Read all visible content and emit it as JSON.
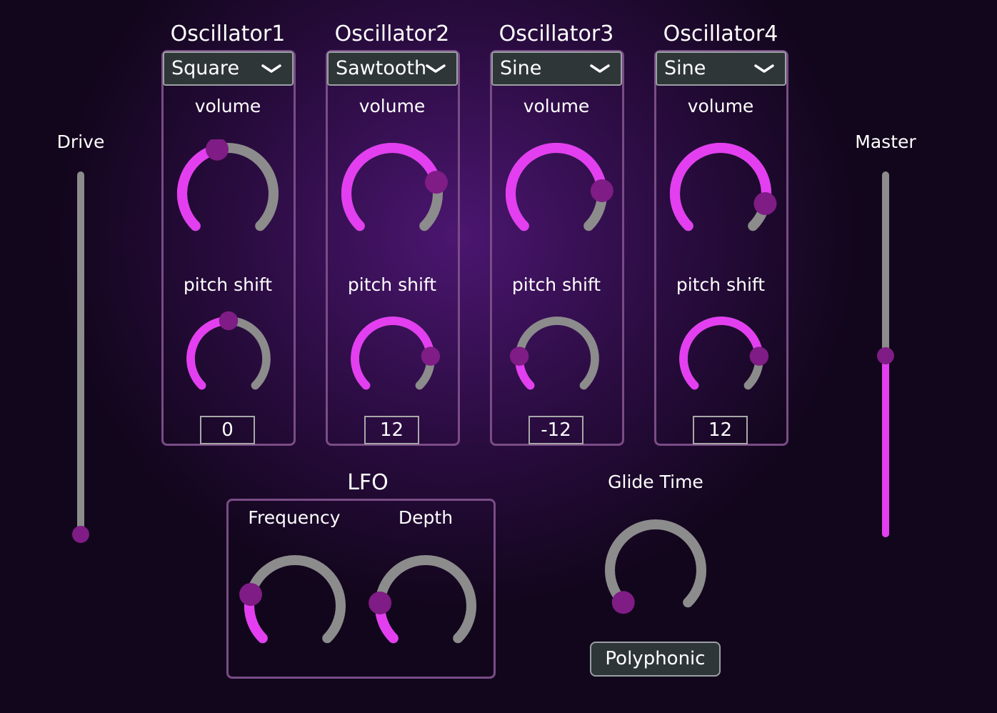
{
  "oscillators": [
    {
      "title": "Oscillator1",
      "waveform": "Square",
      "volume_label": "volume",
      "pitch_label": "pitch shift",
      "pitch_value": "0",
      "volume_level": 0.45,
      "pitch_level": 0.5
    },
    {
      "title": "Oscillator2",
      "waveform": "Sawtooth",
      "volume_label": "volume",
      "pitch_label": "pitch shift",
      "pitch_value": "12",
      "volume_level": 0.78,
      "pitch_level": 0.82
    },
    {
      "title": "Oscillator3",
      "waveform": "Sine",
      "volume_label": "volume",
      "pitch_label": "pitch shift",
      "pitch_value": "-12",
      "volume_level": 0.82,
      "pitch_level": 0.18
    },
    {
      "title": "Oscillator4",
      "waveform": "Sine",
      "volume_label": "volume",
      "pitch_label": "pitch shift",
      "pitch_value": "12",
      "volume_level": 0.88,
      "pitch_level": 0.82
    }
  ],
  "drive": {
    "label": "Drive",
    "level": 0.0
  },
  "master": {
    "label": "Master",
    "level": 0.5
  },
  "lfo": {
    "title": "LFO",
    "frequency_label": "Frequency",
    "depth_label": "Depth",
    "frequency_level": 0.22,
    "depth_level": 0.18
  },
  "glide": {
    "label": "Glide Time",
    "level": 0.0
  },
  "mode_button": "Polyphonic",
  "colors": {
    "accent": "#e33ff0",
    "track": "#8c8c8c",
    "thumb": "#7f1c85",
    "panel_border": "#7a4c86"
  },
  "icons": {
    "dropdown": "chevron-down-icon"
  }
}
